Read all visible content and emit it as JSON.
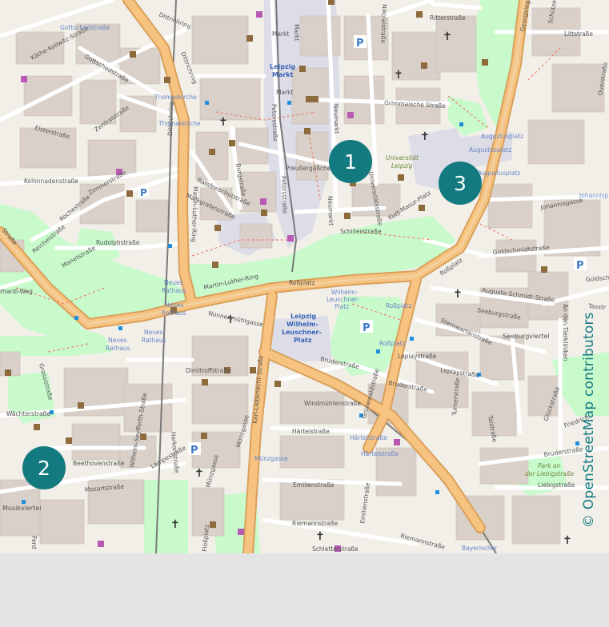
{
  "colors": {
    "land": "#f2efe9",
    "building": "#d9d0c9",
    "park": "#c8facc",
    "major_road": "#f7c380",
    "major_road_casing": "#d9a05b",
    "tram": "#777777",
    "pedestrian": "#dddde8",
    "marker": "#137a7f",
    "attribution": "#137a7f"
  },
  "markers": [
    {
      "label": "1",
      "name": "marker-1"
    },
    {
      "label": "2",
      "name": "marker-2"
    },
    {
      "label": "3",
      "name": "marker-3"
    }
  ],
  "attribution": "© OpenStreetMap contributors",
  "labels": {
    "gottschedstrasse_1": "Gottschedstraße",
    "gottschedstrasse_2": "Gottschedstraße",
    "kathe_kollwitz": "Käthe-Kollwitz-Straße",
    "dittrichring_1": "Dittrichring",
    "dittrichring_2": "Dittrichring",
    "dittrichring_3": "Dittrichring",
    "thomaskirche_1": "Thomaskirche",
    "thomaskirche_2": "Thomaskirche",
    "markt_1": "Markt",
    "markt_2": "Markt",
    "markt_3": "Markt",
    "leipzig_markt": "Leipzig",
    "leipzig_markt_2": "Markt",
    "grimmaische": "Grimmaische Straße",
    "ritterstrasse": "Ritterstraße",
    "nikolaistrasse": "Nikolaistraße",
    "georgiring": "Georgiring",
    "littstrasse": "Littstraße",
    "schutzenstrasse": "Schützenstraße",
    "querstrasse": "Querstraße",
    "augustusplatz_1": "Augustusplatz",
    "augustusplatz_2": "Augustusplatz",
    "augustusplatz_3": "Augustusplatz",
    "johannisplatz": "Johannisplatz",
    "johannisgasse": "Johannisgasse",
    "goldschmidtstrasse": "Goldschmidtstraße",
    "goldschmidt_2": "Goldschm",
    "universitat": "Universität",
    "leipzig_uni": "Leipzig",
    "kurt_masur": "Kurt-Masur-Platz",
    "preussergasschen": "Preußergäßchen",
    "neumarkt_1": "Neumarkt",
    "neumarkt_2": "Neumarkt",
    "universitatsstrasse": "Universitätsstraße",
    "schillerstrasse": "Schillerstraße",
    "petersstrasse_1": "Petersstraße",
    "petersstrasse_2": "Petersstraße",
    "burgstrasse": "Burgstraße",
    "ratsfreischulstrasse": "Ratsfreischulstraße",
    "markgrafenstrasse": "Markgrafenstraße",
    "kolonnadenstrasse": "Kolonnadenstraße",
    "elsterstrasse": "Elsterstraße",
    "zentralstrasse": "Zentralstraße",
    "zimmerstrasse": "Zimmerstraße",
    "rochestrasse": "Rochestraße",
    "reichelstrasse": "Reichelstraße",
    "rudolphstrasse": "Rudolphstraße",
    "manetstrasse": "Manetstraße",
    "martin_luther_ring": "Martin-Luther-Ring",
    "martin_luther_ring_2": "Martin-Luther-Ring",
    "neues_rathaus_1": "Neues",
    "neues_rathaus_2": "Rathaus",
    "neues_rathaus_3": "Neues",
    "neues_rathaus_4": "Rathaus",
    "neues_rathaus_5": "Neues",
    "neues_rathaus_6": "Rathaus",
    "neues_rathaus_7": "Neues",
    "neues_rathaus_8": "Rathaus",
    "rossplatz_1": "Roßplatz",
    "rossplatz_2": "Roßplatz",
    "rossplatz_3": "Roßplatz",
    "rossplatz_4": "Roßplatz",
    "wilhelm_leuschner_1": "Wilhelm-",
    "wilhelm_leuschner_2": "Leuschner-",
    "wilhelm_leuschner_3": "Platz",
    "big_leipzig": "Leipzig",
    "big_wilhelm": "Wilhelm-",
    "big_leuschner": "Leuschner-",
    "big_platz": "Platz",
    "nonnenmuhlgasse": "Nonnenmühlgasse",
    "dimitroffstrasse": "Dimitroffstraße",
    "bruderstrasse_1": "Bruderstraße",
    "bruderstrasse_2": "Bruderstraße",
    "leplaystrasse_1": "Leplaystraße",
    "leplaystrasse_2": "Leplaystraße",
    "grunewaldstrasse": "Grünewaldstraße",
    "windmuhlenstrasse": "Windmühlenstraße",
    "hartelstrasse_1": "Härtelstraße",
    "hartelstrasse_2": "Härtelstraße",
    "hartelstrasse_3": "Härtelstraße",
    "munzgasse_1": "Münzgasse",
    "munzgasse_2": "Münzgasse",
    "munzgasse_3": "Münzgasse",
    "karl_liebknecht": "Karl-Liebknecht-Straße",
    "emilienstrasse_1": "Emilienstraße",
    "emilienstrasse_2": "Emilienstraße",
    "riemannstrasse_1": "Riemannstraße",
    "riemannstrasse_2": "Riemannstraße",
    "schletterstrasse": "Schletterstraße",
    "flossplatz": "Floßplatz",
    "harkortstrasse": "Harkortstraße",
    "grassistrasse": "Grassistraße",
    "wachterstrasse": "Wächterstraße",
    "beethovenstrasse": "Beethovenstraße",
    "mozartstrasse": "Mozartstraße",
    "musikviertel": "Musikviertel",
    "lampestrasse": "Lampestraße",
    "sternwartenstrasse": "Sternwartenstraße",
    "auguste_schmidt": "Auguste-Schmidt-Straße",
    "seeburgstrasse": "Seeburgstraße",
    "seeburgviertel": "Seeburgviertel",
    "talstrasse": "Talstraße",
    "gluckstrasse": "Glückstraße",
    "friedrichstrasse": "Friedrich",
    "brudstrasse_3": "Bruderstraße",
    "park_liebig_1": "Park an",
    "park_liebig_2": "der Liebigstraße",
    "liebigstrasse": "Liebigstraße",
    "turnerstrasse": "Turnerstraße",
    "bayerischer": "Bayerischer",
    "an_den_tierkliniken": "An den Tierkliniken",
    "tasstrasse": "Tasstr",
    "erhardi_weg": "rhardi-Weg",
    "ferd": "Ferd",
    "strasse_edge": "Straße",
    "hindenburg": "Wilhelm-Seyfferth-Straße"
  }
}
